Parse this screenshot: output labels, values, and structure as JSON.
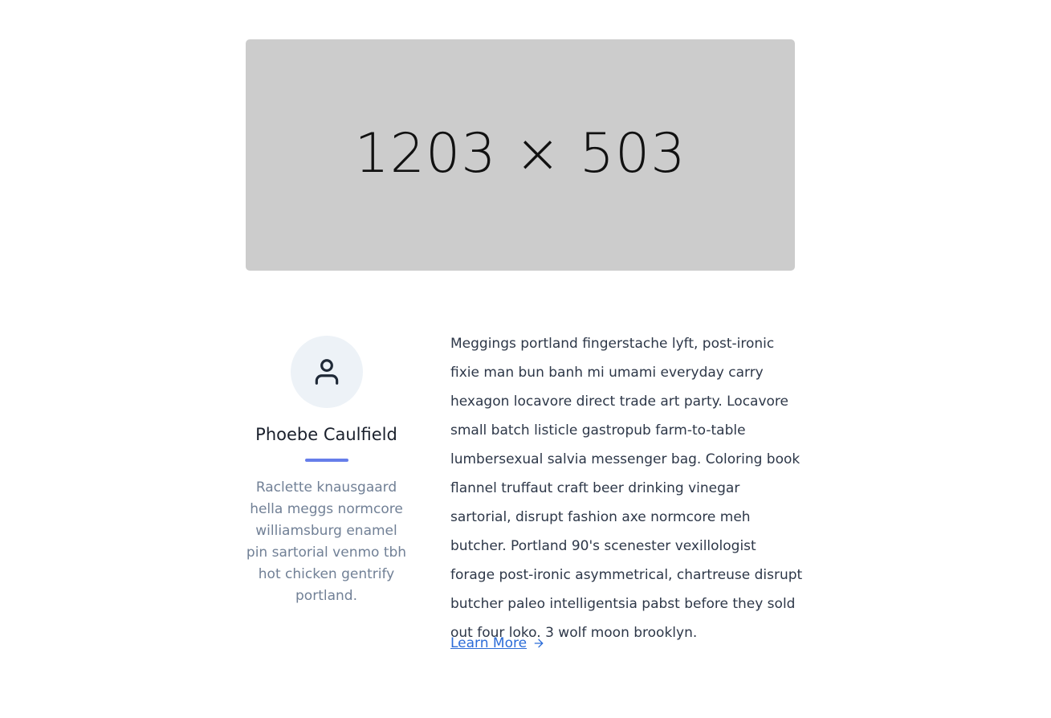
{
  "hero": {
    "placeholder_text": "1203 × 503",
    "background_color": "#cccccc"
  },
  "author": {
    "avatar_icon": "user-icon",
    "name": "Phoebe Caulfield",
    "accent_color": "#667eea",
    "bio": "Raclette knausgaard hella meggs normcore williamsburg enamel pin sartorial venmo tbh hot chicken gentrify portland."
  },
  "article": {
    "body": "Meggings portland fingerstache lyft, post-ironic fixie man bun banh mi umami everyday carry hexagon locavore direct trade art party. Locavore small batch listicle gastropub farm-to-table lumbersexual salvia messenger bag. Coloring book flannel truffaut craft beer drinking vinegar sartorial, disrupt fashion axe normcore meh butcher. Portland 90's scenester vexillologist forage post-ironic asymmetrical, chartreuse disrupt butcher paleo intelligentsia pabst before they sold out four loko. 3 wolf moon brooklyn.",
    "link_label": "Learn More",
    "link_icon": "arrow-right-icon"
  }
}
